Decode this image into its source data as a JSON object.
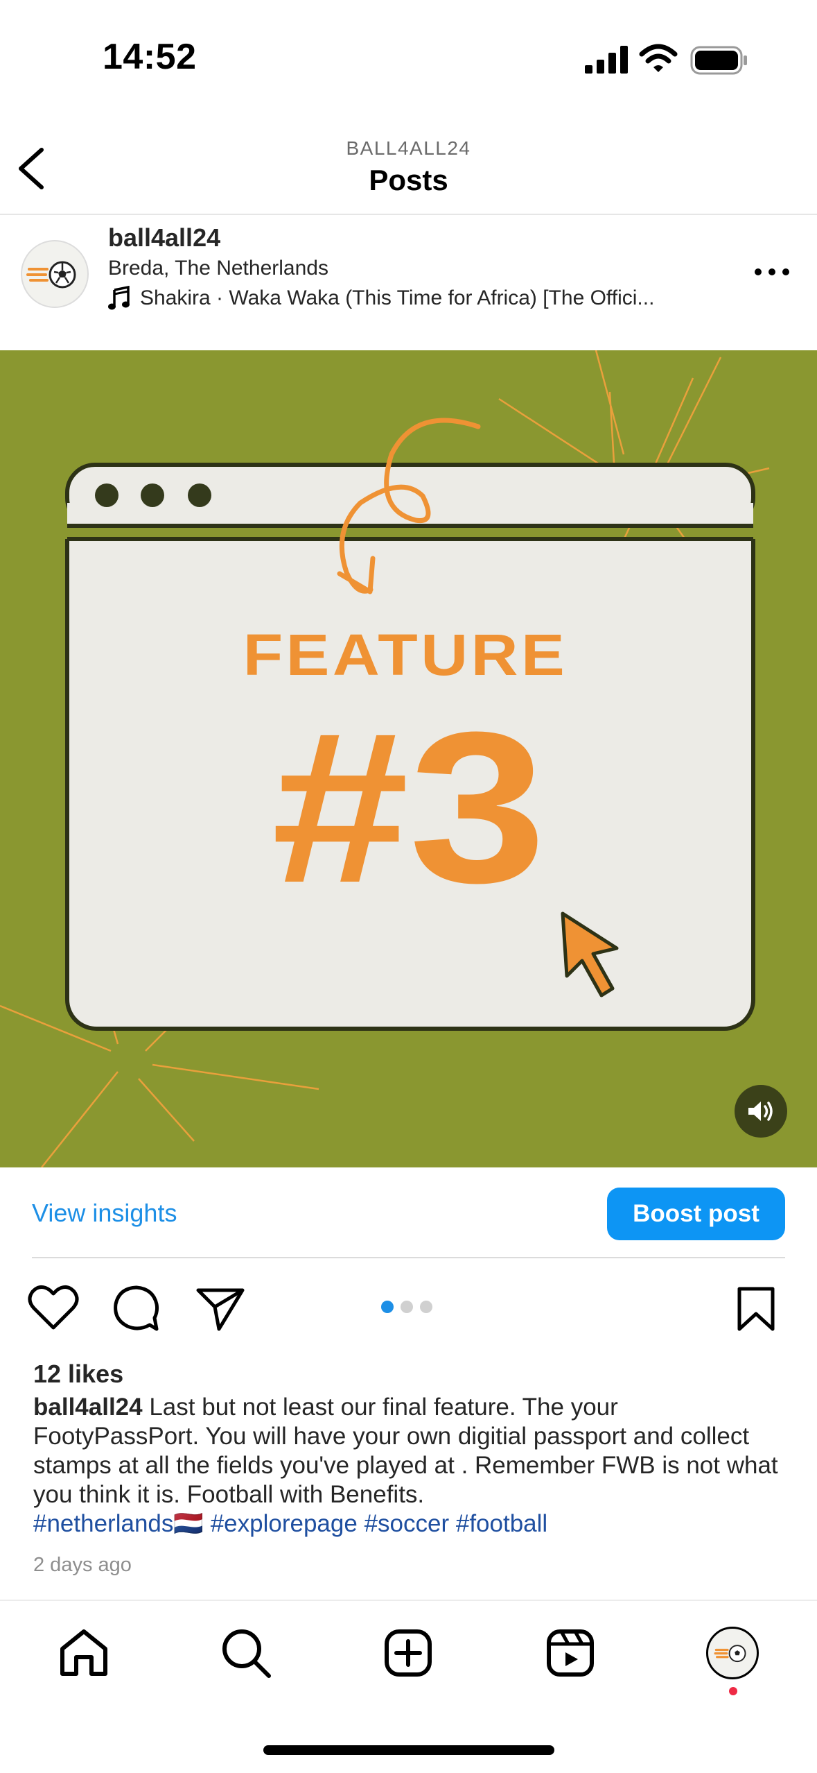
{
  "status": {
    "time": "14:52"
  },
  "header": {
    "eyebrow": "BALL4ALL24",
    "title": "Posts",
    "back_icon": "chevron-left-icon"
  },
  "post": {
    "username": "ball4all24",
    "location": "Breda, The Netherlands",
    "music": "Shakira · Waka Waka (This Time for Africa) [The Offici...",
    "image": {
      "headline": "FEATURE",
      "number": "#3",
      "background_color": "#8a9730",
      "accent_color": "#ef9234"
    },
    "insights_label": "View insights",
    "boost_label": "Boost post",
    "carousel": {
      "count": 3,
      "active": 1
    },
    "likes": "12 likes",
    "caption_user": "ball4all24",
    "caption_text": "Last but not least our final feature. The your FootyPassPort. You will have your own digitial passport and collect stamps at all the fields you've played at . Remember FWB is not what you think it is. Football with Benefits.",
    "hashtags": [
      "#netherlands🇳🇱",
      "#explorepage",
      "#soccer",
      "#football"
    ],
    "time_ago": "2 days ago"
  },
  "colors": {
    "link": "#1d8fe6",
    "button": "#0d95f4",
    "hashtag": "#1f4fa0"
  }
}
